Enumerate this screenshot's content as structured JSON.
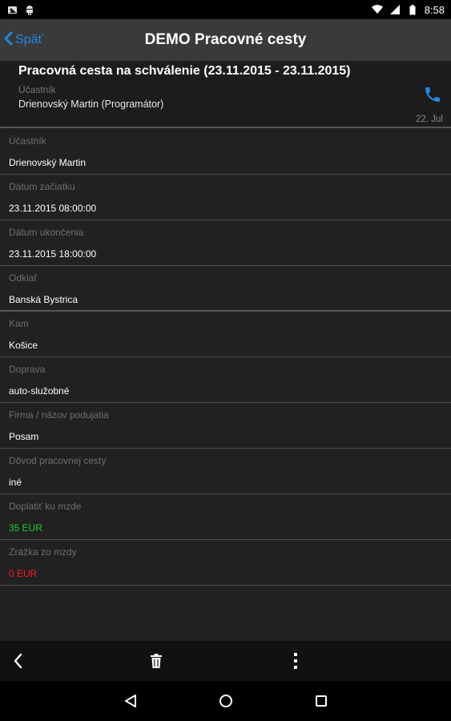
{
  "status_bar": {
    "time": "8:58"
  },
  "app_bar": {
    "back_label": "Späť",
    "title": "DEMO Pracovné cesty"
  },
  "header": {
    "title": "Pracovná cesta na schválenie (23.11.2015 - 23.11.2015)",
    "caption": "Účastník",
    "name": "Drienovský Martin (Programátor)",
    "date": "22. Jul"
  },
  "fields": [
    {
      "label": "Účastník",
      "value": "Drienovský Martin"
    },
    {
      "label": "Dátum začiatku",
      "value": "23.11.2015 08:00:00"
    },
    {
      "label": "Dátum ukončenia",
      "value": "23.11.2015 18:00:00"
    },
    {
      "label": "Odkiaľ",
      "value": "Banská Bystrica"
    },
    {
      "label": "Kam",
      "value": "Košice"
    },
    {
      "label": "Doprava",
      "value": "auto-služobné"
    },
    {
      "label": "Firma / názov podujatia",
      "value": "Posam"
    },
    {
      "label": "Dôvod pracovnej cesty",
      "value": "iné"
    },
    {
      "label": "Doplatiť ku mzde",
      "value": "35 EUR"
    },
    {
      "label": "Zrážka zo mzdy",
      "value": "0 EUR"
    }
  ],
  "colors": {
    "accent": "#1e88e5",
    "positive": "#1fd12a",
    "negative": "#ff1a1a"
  },
  "icons": {
    "status_left": [
      "image-notification-icon",
      "android-notification-icon"
    ],
    "status_right": [
      "wifi-icon",
      "signal-icon",
      "battery-icon"
    ],
    "header": "phone-icon",
    "toolbar": [
      "back-arrow-icon",
      "trash-icon",
      "overflow-menu-icon"
    ],
    "nav": [
      "nav-back-icon",
      "nav-home-icon",
      "nav-recents-icon"
    ]
  }
}
